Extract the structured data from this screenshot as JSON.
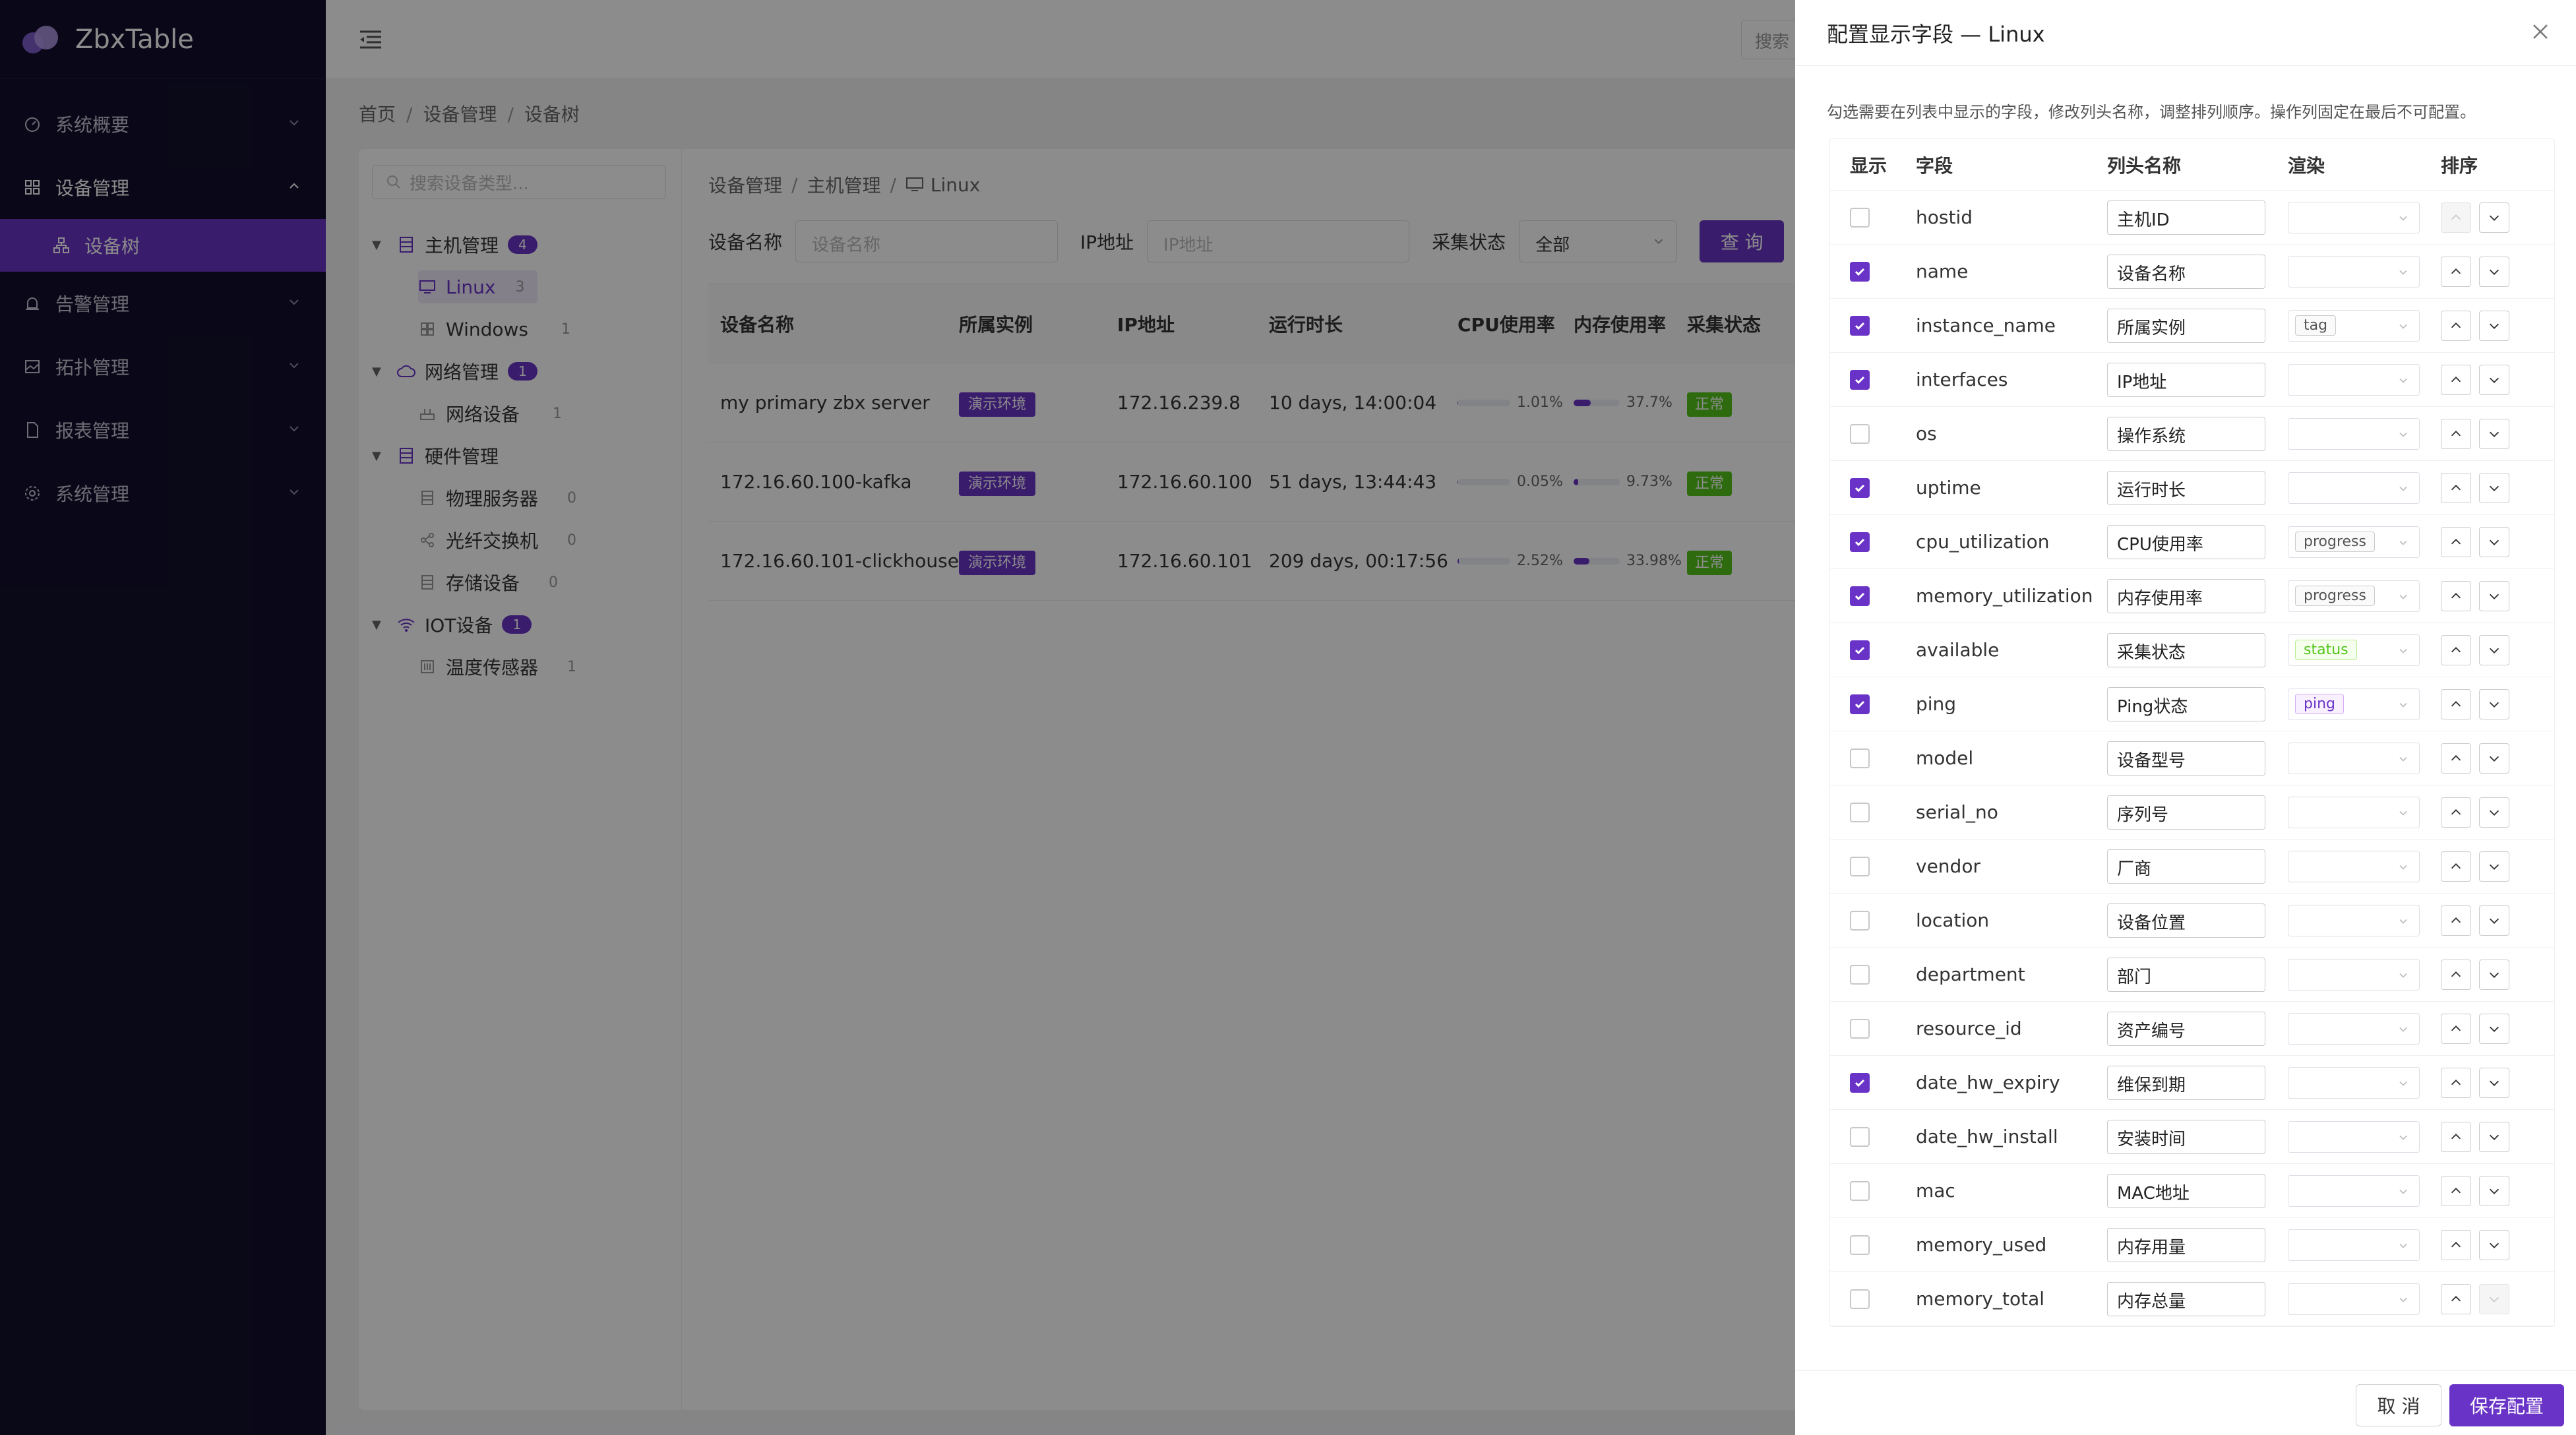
{
  "app": {
    "title": "ZbxTable"
  },
  "colors": {
    "accent": "#6a33c7",
    "sidebar_bg": "#13102c",
    "ok": "#52c41a"
  },
  "sidebar": {
    "items": [
      {
        "label": "系统概要",
        "icon": "dashboard-icon"
      },
      {
        "label": "设备管理",
        "icon": "grid-icon",
        "open": true
      },
      {
        "label": "告警管理",
        "icon": "alarm-icon"
      },
      {
        "label": "拓扑管理",
        "icon": "image-icon"
      },
      {
        "label": "报表管理",
        "icon": "file-icon"
      },
      {
        "label": "系统管理",
        "icon": "gear-icon"
      }
    ],
    "sub_active": "设备树"
  },
  "top": {
    "search_placeholder": "搜索"
  },
  "breadcrumb": [
    "首页",
    "设备管理",
    "设备树"
  ],
  "tree": {
    "search_placeholder": "搜索设备类型...",
    "nodes": [
      {
        "label": "主机管理",
        "badge": "4"
      },
      {
        "label": "Linux",
        "count": "3"
      },
      {
        "label": "Windows",
        "count": "1"
      },
      {
        "label": "网络管理",
        "badge": "1"
      },
      {
        "label": "网络设备",
        "count": "1"
      },
      {
        "label": "硬件管理"
      },
      {
        "label": "物理服务器",
        "count": "0"
      },
      {
        "label": "光纤交换机",
        "count": "0"
      },
      {
        "label": "存储设备",
        "count": "0"
      },
      {
        "label": "IOT设备",
        "badge": "1"
      },
      {
        "label": "温度传感器",
        "count": "1"
      }
    ]
  },
  "inner_breadcrumb": [
    "设备管理",
    "主机管理",
    "Linux"
  ],
  "filters": {
    "name_label": "设备名称",
    "name_placeholder": "设备名称",
    "ip_label": "IP地址",
    "ip_placeholder": "IP地址",
    "status_label": "采集状态",
    "status_value": "全部",
    "query_label": "查 询"
  },
  "device_table": {
    "headers": [
      "设备名称",
      "所属实例",
      "IP地址",
      "运行时长",
      "CPU使用率",
      "内存使用率",
      "采集状态"
    ],
    "rows": [
      {
        "name": "my primary zbx server",
        "instance": "演示环境",
        "ip": "172.16.239.8",
        "uptime": "10 days, 14:00:04",
        "cpu": "1.01%",
        "cpu_pct": 1.01,
        "mem": "37.7%",
        "mem_pct": 37.7,
        "status": "正常"
      },
      {
        "name": "172.16.60.100-kafka",
        "instance": "演示环境",
        "ip": "172.16.60.100",
        "uptime": "51 days, 13:44:43",
        "cpu": "0.05%",
        "cpu_pct": 0.05,
        "mem": "9.73%",
        "mem_pct": 9.73,
        "status": "正常"
      },
      {
        "name": "172.16.60.101-clickhouse",
        "instance": "演示环境",
        "ip": "172.16.60.101",
        "uptime": "209 days, 00:17:56",
        "cpu": "2.52%",
        "cpu_pct": 2.52,
        "mem": "33.98%",
        "mem_pct": 33.98,
        "status": "正常"
      }
    ]
  },
  "drawer": {
    "title": "配置显示字段 — Linux",
    "description": "勾选需要在列表中显示的字段，修改列头名称，调整排列顺序。操作列固定在最后不可配置。",
    "headers": [
      "显示",
      "字段",
      "列头名称",
      "渲染",
      "排序"
    ],
    "fields": [
      {
        "field": "hostid",
        "label": "主机ID",
        "checked": false,
        "render": ""
      },
      {
        "field": "name",
        "label": "设备名称",
        "checked": true,
        "render": ""
      },
      {
        "field": "instance_name",
        "label": "所属实例",
        "checked": true,
        "render": "tag"
      },
      {
        "field": "interfaces",
        "label": "IP地址",
        "checked": true,
        "render": ""
      },
      {
        "field": "os",
        "label": "操作系统",
        "checked": false,
        "render": ""
      },
      {
        "field": "uptime",
        "label": "运行时长",
        "checked": true,
        "render": ""
      },
      {
        "field": "cpu_utilization",
        "label": "CPU使用率",
        "checked": true,
        "render": "progress"
      },
      {
        "field": "memory_utilization",
        "label": "内存使用率",
        "checked": true,
        "render": "progress"
      },
      {
        "field": "available",
        "label": "采集状态",
        "checked": true,
        "render": "status"
      },
      {
        "field": "ping",
        "label": "Ping状态",
        "checked": true,
        "render": "ping"
      },
      {
        "field": "model",
        "label": "设备型号",
        "checked": false,
        "render": ""
      },
      {
        "field": "serial_no",
        "label": "序列号",
        "checked": false,
        "render": ""
      },
      {
        "field": "vendor",
        "label": "厂商",
        "checked": false,
        "render": ""
      },
      {
        "field": "location",
        "label": "设备位置",
        "checked": false,
        "render": ""
      },
      {
        "field": "department",
        "label": "部门",
        "checked": false,
        "render": ""
      },
      {
        "field": "resource_id",
        "label": "资产编号",
        "checked": false,
        "render": ""
      },
      {
        "field": "date_hw_expiry",
        "label": "维保到期",
        "checked": true,
        "render": ""
      },
      {
        "field": "date_hw_install",
        "label": "安装时间",
        "checked": false,
        "render": ""
      },
      {
        "field": "mac",
        "label": "MAC地址",
        "checked": false,
        "render": ""
      },
      {
        "field": "memory_used",
        "label": "内存用量",
        "checked": false,
        "render": ""
      },
      {
        "field": "memory_total",
        "label": "内存总量",
        "checked": false,
        "render": ""
      }
    ],
    "cancel_label": "取 消",
    "save_label": "保存配置"
  }
}
